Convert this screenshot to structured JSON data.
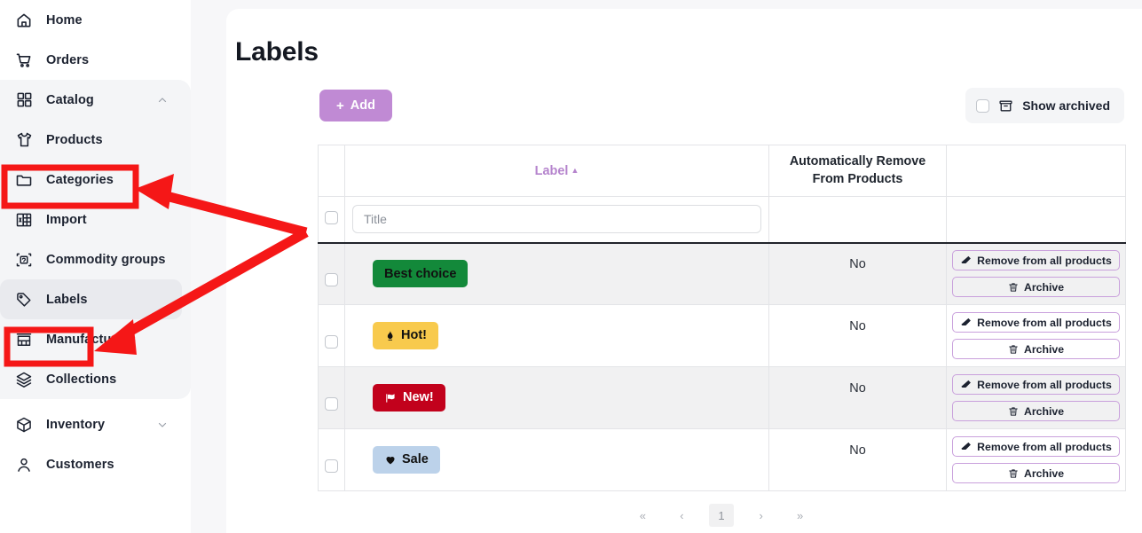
{
  "sidebar": {
    "items": [
      {
        "label": "Home",
        "icon": "home-icon"
      },
      {
        "label": "Orders",
        "icon": "cart-icon"
      },
      {
        "label": "Catalog",
        "icon": "grid-icon",
        "chevron": "chevron-up-icon"
      },
      {
        "label": "Products",
        "icon": "tshirt-icon"
      },
      {
        "label": "Categories",
        "icon": "folder-icon"
      },
      {
        "label": "Import",
        "icon": "spreadsheet-icon"
      },
      {
        "label": "Commodity groups",
        "icon": "commodity-icon"
      },
      {
        "label": "Labels",
        "icon": "tag-icon"
      },
      {
        "label": "Manufacturers",
        "icon": "store-icon"
      },
      {
        "label": "Collections",
        "icon": "layers-icon"
      },
      {
        "label": "Inventory",
        "icon": "box-icon",
        "chevron": "chevron-down-icon"
      },
      {
        "label": "Customers",
        "icon": "user-icon"
      }
    ]
  },
  "page": {
    "title": "Labels"
  },
  "toolbar": {
    "add_label": "Add",
    "add_icon": "plus-icon",
    "show_archived_label": "Show archived",
    "show_archived_icon": "archive-icon",
    "show_archived_checked": false
  },
  "table": {
    "columns": {
      "checkbox": "",
      "label": "Label",
      "label_sort": "▲",
      "auto_remove": "Automatically Remove From Products",
      "actions": ""
    },
    "filter": {
      "title_placeholder": "Title",
      "title_value": ""
    },
    "actions": {
      "remove_label": "Remove from all products",
      "remove_icon": "eraser-icon",
      "archive_label": "Archive",
      "archive_icon": "trash-icon"
    },
    "rows": [
      {
        "badge_text": "Best choice",
        "badge_icon": "",
        "badge_bg": "#13893a",
        "badge_color": "#111111",
        "auto_remove": "No"
      },
      {
        "badge_text": "Hot!",
        "badge_icon": "flame-icon",
        "badge_bg": "#f8ca4d",
        "badge_color": "#111111",
        "auto_remove": "No"
      },
      {
        "badge_text": "New!",
        "badge_icon": "flag-icon",
        "badge_bg": "#c2011c",
        "badge_color": "#ffffff",
        "auto_remove": "No"
      },
      {
        "badge_text": "Sale",
        "badge_icon": "heart-icon",
        "badge_bg": "#bcd2ea",
        "badge_color": "#111111",
        "auto_remove": "No"
      }
    ]
  },
  "pagination": {
    "first": "«",
    "prev": "‹",
    "current": "1",
    "next": "›",
    "last": "»"
  },
  "annotation": {
    "color": "#f51717",
    "highlight_products": "Products",
    "highlight_labels": "Labels"
  },
  "colors": {
    "accent_purple": "#c08ad4",
    "header_label_purple": "#b584cd",
    "row_alt": "#f1f1f2",
    "sidebar_bg": "#ffffff",
    "page_bg": "#f7f7f9"
  }
}
